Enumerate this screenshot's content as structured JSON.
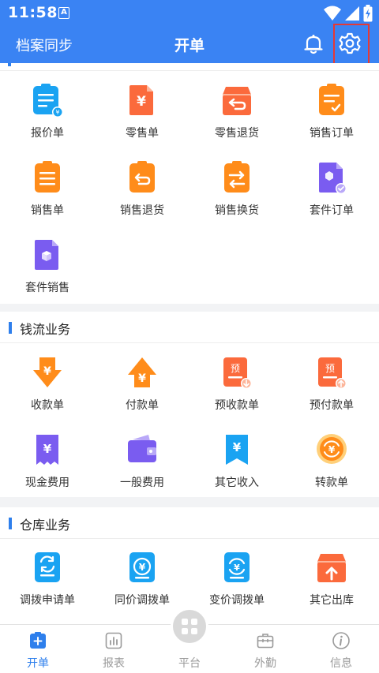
{
  "status_bar": {
    "time": "11:58",
    "notification_icon_letter": "A"
  },
  "app_bar": {
    "left_label": "档案同步",
    "title": "开单"
  },
  "colors": {
    "primary": "#3a83f3",
    "orange": "#ff8c1a",
    "red_orange": "#fb6a3c",
    "blue": "#1aa3f2",
    "purple": "#7a5cf0",
    "highlight_red": "#e53935"
  },
  "sales": {
    "items": [
      {
        "label": "报价单",
        "icon": "quote-clipboard-icon"
      },
      {
        "label": "零售单",
        "icon": "retail-yen-doc-icon"
      },
      {
        "label": "零售退货",
        "icon": "retail-return-box-icon"
      },
      {
        "label": "销售订单",
        "icon": "sales-order-clipboard-icon"
      },
      {
        "label": "销售单",
        "icon": "sales-clipboard-icon"
      },
      {
        "label": "销售退货",
        "icon": "sales-return-clipboard-icon"
      },
      {
        "label": "销售换货",
        "icon": "sales-exchange-clipboard-icon"
      },
      {
        "label": "套件订单",
        "icon": "kit-order-doc-icon"
      },
      {
        "label": "套件销售",
        "icon": "kit-sales-doc-icon"
      }
    ]
  },
  "cash": {
    "title": "钱流业务",
    "items": [
      {
        "label": "收款单",
        "icon": "receipt-arrow-down-icon"
      },
      {
        "label": "付款单",
        "icon": "payment-arrow-up-icon"
      },
      {
        "label": "预收款单",
        "icon": "prepaid-receive-doc-icon",
        "glyph": "预"
      },
      {
        "label": "预付款单",
        "icon": "prepaid-pay-doc-icon",
        "glyph": "预"
      },
      {
        "label": "现金费用",
        "icon": "cash-expense-receipt-icon"
      },
      {
        "label": "一般费用",
        "icon": "wallet-icon"
      },
      {
        "label": "其它收入",
        "icon": "other-income-ribbon-icon"
      },
      {
        "label": "转款单",
        "icon": "transfer-coin-icon"
      }
    ]
  },
  "warehouse": {
    "title": "仓库业务",
    "items": [
      {
        "label": "调拨申请单",
        "icon": "transfer-request-icon"
      },
      {
        "label": "同价调拨单",
        "icon": "same-price-transfer-icon"
      },
      {
        "label": "变价调拨单",
        "icon": "price-change-transfer-icon"
      },
      {
        "label": "其它出库",
        "icon": "other-outbound-box-icon"
      }
    ]
  },
  "bottom_nav": [
    {
      "label": "开单",
      "icon": "new-order-icon",
      "active": true
    },
    {
      "label": "报表",
      "icon": "report-chart-icon",
      "active": false
    },
    {
      "label": "平台",
      "icon": "platform-grid-icon",
      "active": false
    },
    {
      "label": "外勤",
      "icon": "field-work-bag-icon",
      "active": false
    },
    {
      "label": "信息",
      "icon": "info-icon",
      "active": false
    }
  ]
}
